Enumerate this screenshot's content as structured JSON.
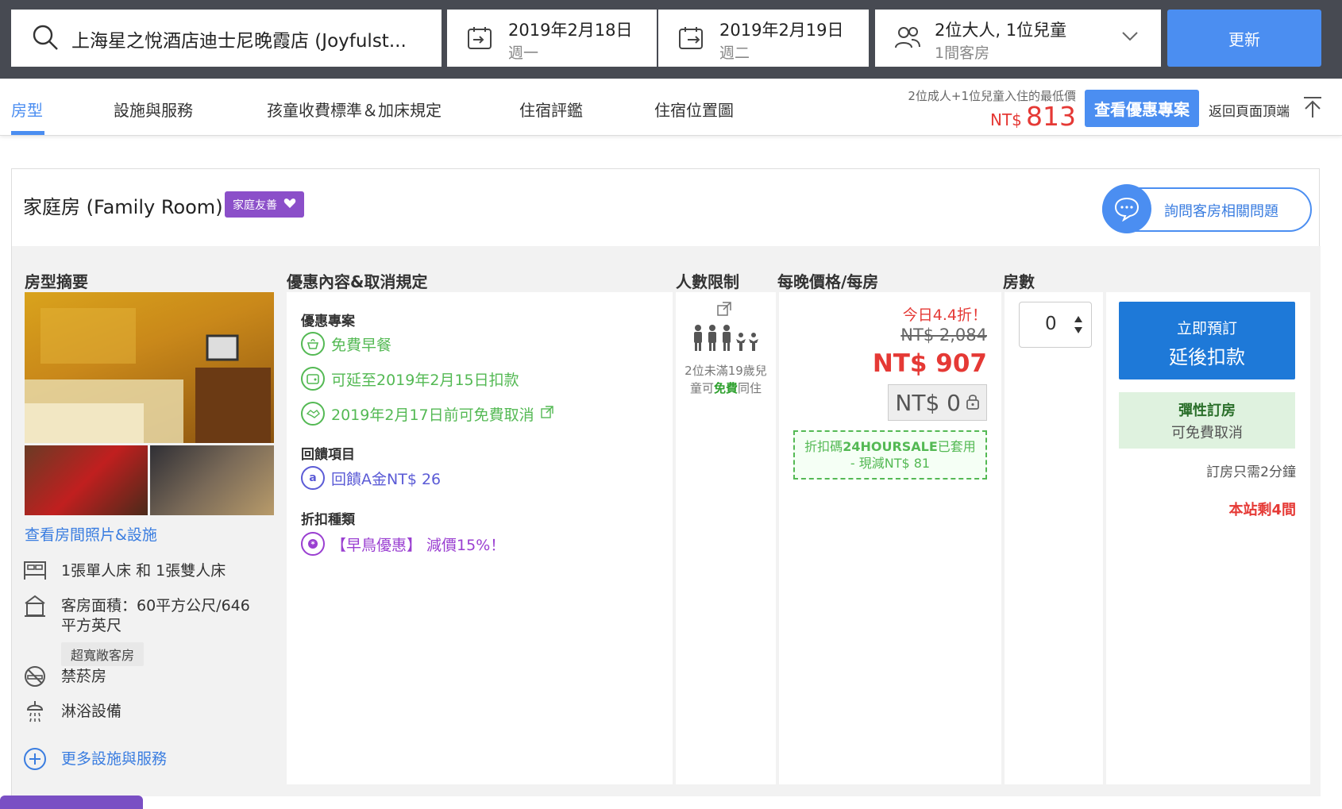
{
  "search": {
    "hotel": "上海星之悅酒店迪士尼晚霞店 (Joyfulst...",
    "checkin_date": "2019年2月18日",
    "checkin_day": "週一",
    "checkout_date": "2019年2月19日",
    "checkout_day": "週二",
    "guests": "2位大人, 1位兒童",
    "rooms": "1間客房",
    "update_label": "更新"
  },
  "tabs": [
    "房型",
    "設施與服務",
    "孩童收費標準＆加床規定",
    "住宿評鑑",
    "住宿位置圖"
  ],
  "lowest": {
    "label": "2位成人+1位兒童入住的最低價",
    "currency": "NT$",
    "amount": "813",
    "deals_button": "查看優惠專案",
    "back_top": "返回頁面頂端"
  },
  "room": {
    "title": "家庭房 (Family Room)",
    "badge": "家庭友善",
    "ask": "詢問客房相關問題",
    "headers": {
      "summary": "房型摘要",
      "deals": "優惠內容&取消規定",
      "occupancy": "人數限制",
      "price": "每晚價格/每房",
      "rooms": "房數"
    },
    "photo_link": "查看房間照片&設施",
    "features": {
      "bed": "1張單人床 和 1張雙人床",
      "area_l1": "客房面積：60平方公尺/646",
      "area_l2": "平方英尺",
      "size_tag": "超寬敞客房",
      "nosmoke": "禁菸房",
      "shower": "淋浴設備",
      "more": "更多設施與服務"
    },
    "deals": {
      "promo_title": "優惠專案",
      "breakfast": "免費早餐",
      "pay_later": "可延至2019年2月15日扣款",
      "free_cancel": "2019年2月17日前可免費取消",
      "reward_title": "回饋項目",
      "reward": "回饋A金NT$ 26",
      "discount_title": "折扣種類",
      "discount": "【早鳥優惠】 減價15%！"
    },
    "occupancy": {
      "note_pre": "2位未滿19歲兒童可",
      "note_free": "免費",
      "note_post": "同住"
    },
    "price": {
      "discount_label": "今日4.4折！",
      "original": "NT$ 2,084",
      "current": "NT$ 907",
      "locked": "NT$ 0",
      "coupon_pre": "折扣碼",
      "coupon_code": "24HOURSALE",
      "coupon_post": "已套用",
      "coupon_line2": "- 現減NT$ 81"
    },
    "rooms_value": "0",
    "book": {
      "line1": "立即預訂",
      "line2": "延後扣款",
      "flex_title": "彈性訂房",
      "flex_sub": "可免費取消",
      "minutes": "訂房只需2分鐘",
      "left": "本站剩4間"
    }
  },
  "colors": {
    "accent": "#4b8ef1",
    "price_red": "#e53935",
    "green": "#54b954",
    "badge_purple": "#8b4fc9"
  }
}
